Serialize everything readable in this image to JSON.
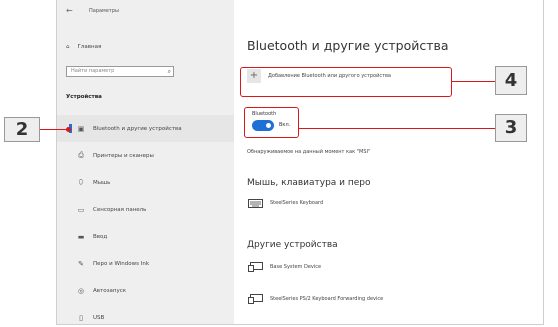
{
  "window": {
    "title": "Параметры",
    "back_icon": "back-arrow-icon"
  },
  "sidebar": {
    "home_label": "Главная",
    "search_placeholder": "Найти параметр",
    "section_label": "Устройства",
    "items": [
      {
        "label": "Bluetooth и другие устройства",
        "icon": "bluetooth-icon",
        "active": true
      },
      {
        "label": "Принтеры и сканеры",
        "icon": "printer-icon"
      },
      {
        "label": "Мышь",
        "icon": "mouse-icon"
      },
      {
        "label": "Сенсорная панель",
        "icon": "touchpad-icon"
      },
      {
        "label": "Ввод",
        "icon": "keyboard-icon"
      },
      {
        "label": "Перо и Windows Ink",
        "icon": "pen-icon"
      },
      {
        "label": "Автозапуск",
        "icon": "autoplay-icon"
      },
      {
        "label": "USB",
        "icon": "usb-icon"
      }
    ]
  },
  "main": {
    "title": "Bluetooth и другие устройства",
    "add_device_label": "Добавление Bluetooth или другого устройства",
    "bluetooth_label": "Bluetooth",
    "bluetooth_state": "Вкл.",
    "bluetooth_on": true,
    "discoverable_text": "Обнаруживаемое на данный момент как \"MSI\"",
    "mouse_heading": "Мышь, клавиатура и перо",
    "mouse_devices": [
      {
        "name": "SteelSeries Keyboard",
        "icon": "keyboard-icon"
      }
    ],
    "other_heading": "Другие устройства",
    "other_devices": [
      {
        "name": "Base System Device",
        "icon": "device-icon"
      },
      {
        "name": "SteelSeries PS/2 Keyboard Forwarding device",
        "icon": "device-icon"
      }
    ]
  },
  "callouts": [
    {
      "number": "2"
    },
    {
      "number": "3"
    },
    {
      "number": "4"
    }
  ],
  "colors": {
    "accent": "#1f6fd6",
    "callout_line": "#d7191c",
    "sidebar_bg": "#efefef"
  }
}
